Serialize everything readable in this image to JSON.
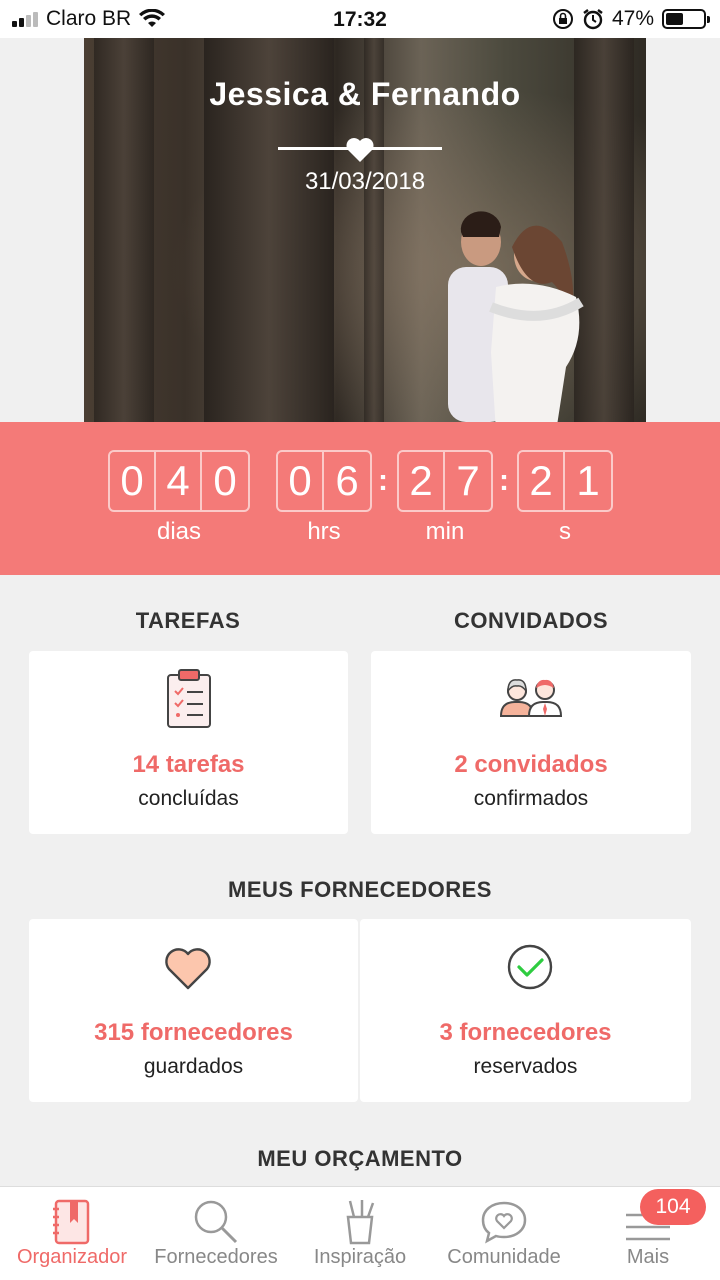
{
  "status_bar": {
    "carrier": "Claro BR",
    "time": "17:32",
    "battery_percent": "47%",
    "battery_level": 0.47
  },
  "hero": {
    "couple_names": "Jessica & Fernando",
    "wedding_date": "31/03/2018"
  },
  "countdown": {
    "days_digits": [
      "0",
      "4",
      "0"
    ],
    "hours_digits": [
      "0",
      "6"
    ],
    "minutes_digits": [
      "2",
      "7"
    ],
    "seconds_digits": [
      "2",
      "1"
    ],
    "separator": ":",
    "labels": {
      "days": "dias",
      "hours": "hrs",
      "minutes": "min",
      "seconds": "s"
    }
  },
  "tasks": {
    "title": "TAREFAS",
    "value": "14 tarefas",
    "subtitle": "concluídas"
  },
  "guests": {
    "title": "CONVIDADOS",
    "value": "2 convidados",
    "subtitle": "confirmados"
  },
  "vendors": {
    "title": "MEUS FORNECEDORES",
    "saved_value": "315 fornecedores",
    "saved_subtitle": "guardados",
    "booked_value": "3 fornecedores",
    "booked_subtitle": "reservados"
  },
  "budget": {
    "title": "MEU ORÇAMENTO"
  },
  "bottom_nav": {
    "items": [
      {
        "label": "Organizador",
        "icon": "notebook-icon",
        "active": true
      },
      {
        "label": "Fornecedores",
        "icon": "search-icon",
        "active": false
      },
      {
        "label": "Inspiração",
        "icon": "pencil-cup-icon",
        "active": false
      },
      {
        "label": "Comunidade",
        "icon": "chat-heart-icon",
        "active": false
      },
      {
        "label": "Mais",
        "icon": "menu-icon",
        "active": false
      }
    ],
    "badge": "104"
  },
  "colors": {
    "accent": "#ef6a68",
    "countdown_bg": "#f47a78",
    "page_bg": "#f0f0f0"
  }
}
